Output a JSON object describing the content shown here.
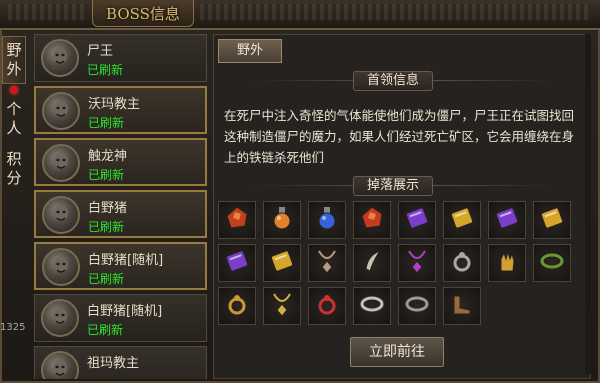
{
  "window": {
    "title": "BOSS信息"
  },
  "side_tabs": [
    {
      "label": "野外",
      "active": true
    },
    {
      "label": "个人",
      "active": false,
      "has_alert": true
    },
    {
      "label": "积分",
      "active": false
    }
  ],
  "stray_text": "1325",
  "boss_list": [
    {
      "name": "尸王",
      "status": "已刷新",
      "selected": false
    },
    {
      "name": "沃玛教主",
      "status": "已刷新",
      "selected": true
    },
    {
      "name": "触龙神",
      "status": "已刷新",
      "selected": true
    },
    {
      "name": "白野猪",
      "status": "已刷新",
      "selected": true
    },
    {
      "name": "白野猪[随机]",
      "status": "已刷新",
      "selected": true
    },
    {
      "name": "白野猪[随机]",
      "status": "已刷新",
      "selected": false
    },
    {
      "name": "祖玛教主",
      "status": "",
      "selected": false
    }
  ],
  "panel": {
    "tab_label": "野外",
    "info_header": "首领信息",
    "description": "在死尸中注入奇怪的气体能使他们成为僵尸，尸王正在试图找回这种制造僵尸的魔力，如果人们经过死亡矿区，它会用缠绕在身上的铁链杀死他们",
    "drops_header": "掉落展示",
    "go_button": "立即前往"
  },
  "drop_items": [
    {
      "icon": "red-ore-icon",
      "color": "#c0401c"
    },
    {
      "icon": "orange-potion-icon",
      "color": "#e0822a"
    },
    {
      "icon": "blue-potion-icon",
      "color": "#3a62d8"
    },
    {
      "icon": "red-crystal-icon",
      "color": "#c83a1e"
    },
    {
      "icon": "purple-book-icon",
      "color": "#7a3ec8"
    },
    {
      "icon": "gold-book-icon",
      "color": "#d6a52a"
    },
    {
      "icon": "purple-book-icon",
      "color": "#7a3ec8"
    },
    {
      "icon": "gold-book-icon",
      "color": "#d6a52a"
    },
    {
      "icon": "purple-book-icon",
      "color": "#7a3ec8"
    },
    {
      "icon": "gold-book-icon",
      "color": "#d6a52a"
    },
    {
      "icon": "spiked-amulet-icon",
      "color": "#b89a7a"
    },
    {
      "icon": "horn-dagger-icon",
      "color": "#c8c0b0"
    },
    {
      "icon": "gem-necklace-icon",
      "color": "#b040c0"
    },
    {
      "icon": "silver-ring-icon",
      "color": "#a8a8a8"
    },
    {
      "icon": "gold-gauntlet-icon",
      "color": "#d0a030"
    },
    {
      "icon": "green-bracelet-icon",
      "color": "#6a9a30"
    },
    {
      "icon": "gold-ring-icon",
      "color": "#c89a30"
    },
    {
      "icon": "gold-necklace-icon",
      "color": "#d8b040"
    },
    {
      "icon": "ruby-ring-icon",
      "color": "#d03030"
    },
    {
      "icon": "silver-chain-icon",
      "color": "#c0c0c0"
    },
    {
      "icon": "stone-bracelet-icon",
      "color": "#9a9a9a"
    },
    {
      "icon": "leather-boots-icon",
      "color": "#9a6a3a"
    }
  ]
}
